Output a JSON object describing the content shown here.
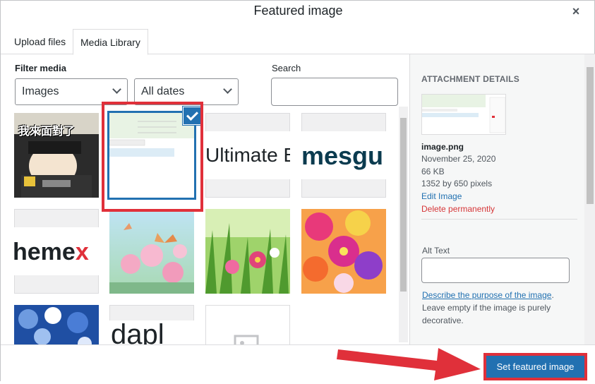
{
  "modal": {
    "title": "Featured image",
    "close_symbol": "×"
  },
  "tabs": [
    {
      "label": "Upload files"
    },
    {
      "label": "Media Library"
    }
  ],
  "filters": {
    "label": "Filter media",
    "type_value": "Images",
    "date_value": "All dates",
    "search_label": "Search",
    "search_value": ""
  },
  "thumbnails": [
    {
      "name": "cartoon-avatar",
      "text": "我來面對了"
    },
    {
      "name": "selected-image-png",
      "text": ""
    },
    {
      "name": "ultimate-b-logo",
      "text": "Ultimate B"
    },
    {
      "name": "mesgu-logo",
      "text": "mesgu"
    },
    {
      "name": "hemex-logo",
      "text": "hemex"
    },
    {
      "name": "butterfly-flowers",
      "text": ""
    },
    {
      "name": "green-flowers",
      "text": ""
    },
    {
      "name": "colorful-flowers",
      "text": ""
    },
    {
      "name": "blue-flowers",
      "text": ""
    },
    {
      "name": "dark-logo",
      "text": "dapl"
    },
    {
      "name": "placeholder-image",
      "text": ""
    }
  ],
  "attachment": {
    "heading": "ATTACHMENT DETAILS",
    "filename": "image.png",
    "date": "November 25, 2020",
    "size": "66 KB",
    "dimensions": "1352 by 650 pixels",
    "edit_link": "Edit Image",
    "delete_link": "Delete permanently",
    "alt_label": "Alt Text",
    "alt_value": "",
    "alt_help_link": "Describe the purpose of the image",
    "alt_help_punct": ".",
    "alt_help_text": "Leave empty if the image is purely decorative."
  },
  "footer": {
    "button_label": "Set featured image"
  },
  "colors": {
    "accent": "#2271b1",
    "highlight": "#e0303a"
  }
}
